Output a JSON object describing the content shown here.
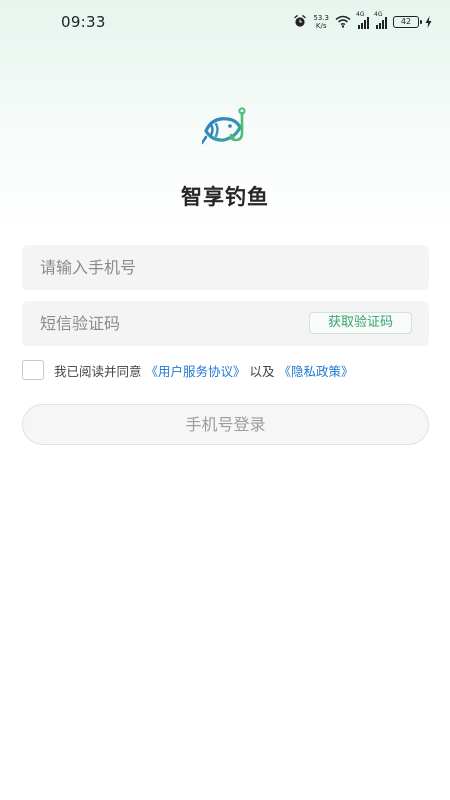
{
  "status_bar": {
    "time": "09:33",
    "net_speed_value": "53.3",
    "net_speed_unit": "K/s",
    "signal_tag_1": "4G",
    "signal_tag_2": "4G",
    "battery": "42",
    "icons": [
      "alarm-icon",
      "wifi-icon",
      "signal-icon",
      "signal-icon",
      "battery-icon",
      "charging-icon"
    ]
  },
  "app": {
    "title": "智享钓鱼",
    "logo": "fish-hook-logo",
    "brand_color": "#3aa070"
  },
  "form": {
    "phone_placeholder": "请输入手机号",
    "phone_value": "",
    "code_placeholder": "短信验证码",
    "code_value": "",
    "get_code_label": "获取验证码"
  },
  "agreement": {
    "checked": false,
    "prefix": "我已阅读并同意",
    "user_agreement": "《用户服务协议》",
    "conjunction": "以及",
    "privacy_policy": "《隐私政策》",
    "link_color": "#1f7ad1"
  },
  "login_button_label": "手机号登录"
}
